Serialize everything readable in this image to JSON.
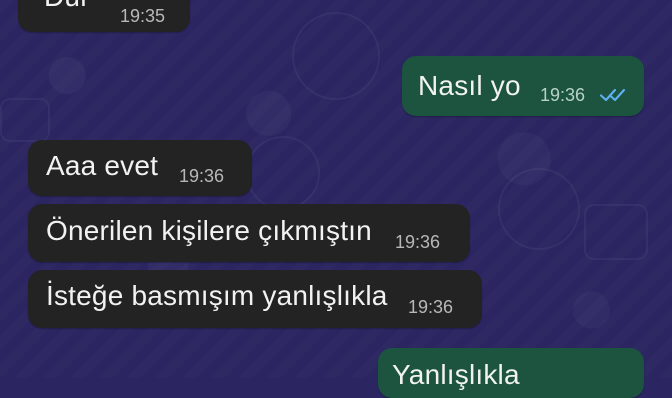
{
  "theme": {
    "background": "#2b2561",
    "incoming_bubble": "#232323",
    "outgoing_bubble": "#1c5440",
    "read_receipt": "#5fb0f2"
  },
  "messages": [
    {
      "direction": "incoming",
      "text": "Dur",
      "time": "19:35"
    },
    {
      "direction": "outgoing",
      "text": "Nasıl yo",
      "time": "19:36",
      "status_icon": "double-check-read-icon"
    },
    {
      "direction": "incoming",
      "text": "Aaa evet",
      "time": "19:36"
    },
    {
      "direction": "incoming",
      "text": "Önerilen kişilere çıkmıştın",
      "time": "19:36"
    },
    {
      "direction": "incoming",
      "text": "İsteğe basmışım yanlışlıkla",
      "time": "19:36"
    },
    {
      "direction": "outgoing",
      "text": "Yanlışlıkla",
      "time": ""
    }
  ]
}
